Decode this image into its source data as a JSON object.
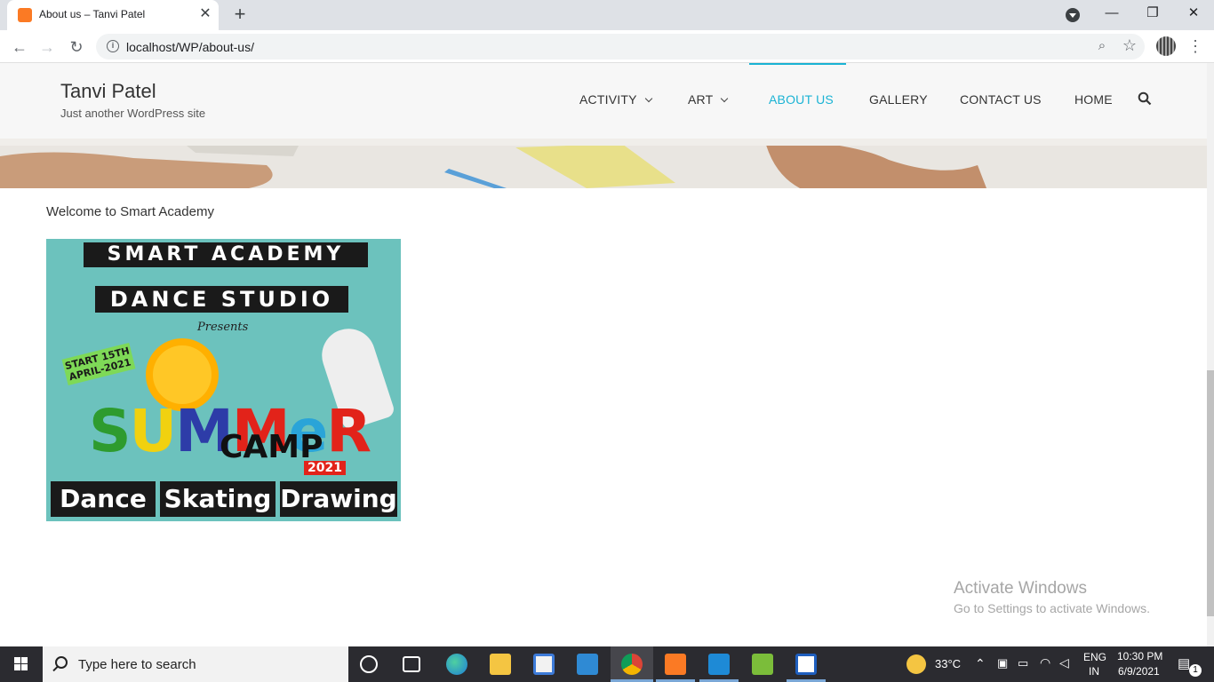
{
  "browser": {
    "tab_title": "About us – Tanvi Patel",
    "url": "localhost/WP/about-us/",
    "new_tab": "+",
    "close_tab": "✕"
  },
  "window_controls": {
    "minimize": "—",
    "maximize": "❐",
    "close": "✕"
  },
  "site": {
    "title": "Tanvi Patel",
    "tagline": "Just another WordPress site",
    "nav": [
      {
        "label": "ACTIVITY",
        "has_dropdown": true
      },
      {
        "label": "ART",
        "has_dropdown": true
      },
      {
        "label": "ABOUT US",
        "active": true
      },
      {
        "label": "GALLERY"
      },
      {
        "label": "CONTACT US"
      },
      {
        "label": "HOME"
      }
    ],
    "accent_color": "#1ab3d4"
  },
  "content": {
    "welcome_text": "Welcome to Smart Academy",
    "poster": {
      "line1": "SMART ACADEMY",
      "line2": "DANCE STUDIO",
      "presents": "Presents",
      "start": "START 15TH APRIL-2021",
      "summer": [
        "S",
        "U",
        "M",
        "M",
        "e",
        "R"
      ],
      "camp": "CAMP",
      "year": "2021",
      "activities": [
        "Dance",
        "Skating",
        "Drawing"
      ]
    }
  },
  "watermark": {
    "title": "Activate Windows",
    "subtitle": "Go to Settings to activate Windows."
  },
  "taskbar": {
    "search_placeholder": "Type here to search",
    "weather": "33°C",
    "language_top": "ENG",
    "language_bottom": "IN",
    "time": "10:30 PM",
    "date": "6/9/2021",
    "notification_count": "1"
  }
}
